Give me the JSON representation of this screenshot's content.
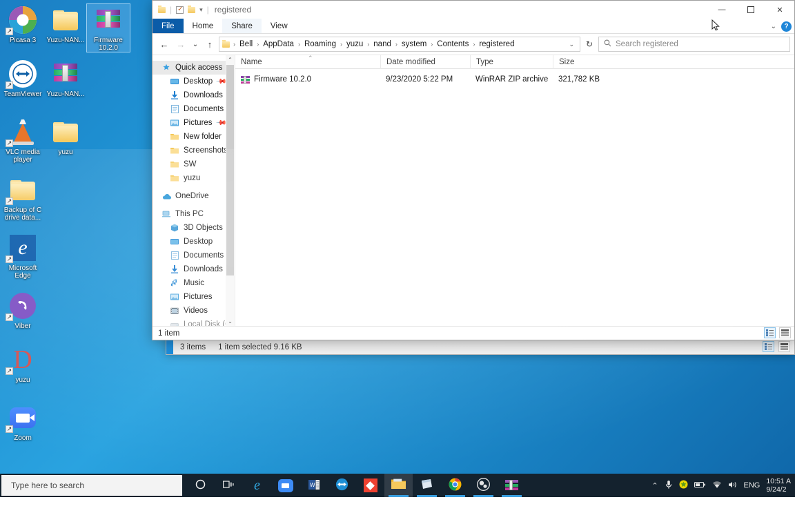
{
  "desktop": {
    "icons_col1": [
      {
        "label": "Picasa 3",
        "icon": "picasa-icon",
        "shortcut": true,
        "selected": false
      },
      {
        "label": "TeamViewer",
        "icon": "teamviewer-icon",
        "shortcut": true,
        "selected": false
      },
      {
        "label": "VLC media player",
        "icon": "vlc-icon",
        "shortcut": true,
        "selected": false
      },
      {
        "label": "Backup of C drive data...",
        "icon": "folder-icon",
        "shortcut": true,
        "selected": false
      },
      {
        "label": "Microsoft Edge",
        "icon": "edge-icon",
        "shortcut": true,
        "selected": false
      },
      {
        "label": "Viber",
        "icon": "viber-icon",
        "shortcut": true,
        "selected": false
      },
      {
        "label": "yuzu",
        "icon": "yuzu-icon",
        "shortcut": true,
        "selected": false
      },
      {
        "label": "Zoom",
        "icon": "zoom-icon",
        "shortcut": true,
        "selected": false
      }
    ],
    "icons_col2": [
      {
        "label": "Yuzu-NAN...",
        "icon": "folder-icon",
        "shortcut": false,
        "selected": false
      },
      {
        "label": "Yuzu-NAN...",
        "icon": "winrar-archive-icon",
        "shortcut": false,
        "selected": false
      },
      {
        "label": "yuzu",
        "icon": "folder-icon",
        "shortcut": false,
        "selected": false
      }
    ],
    "icons_col3": [
      {
        "label": "Firmware 10.2.0",
        "icon": "winrar-archive-icon",
        "shortcut": false,
        "selected": true
      }
    ]
  },
  "window": {
    "title": "registered",
    "quick_access": {
      "folder_icon": "folder-icon",
      "properties_icon": "properties-checkbox-icon",
      "new_folder_icon": "new-folder-icon",
      "dropdown_icon": "chevron-down-icon",
      "separator": "|"
    },
    "controls": {
      "minimize": "—",
      "maximize": "☐",
      "close": "✕",
      "ribbon_collapse": "⌄",
      "help": "?"
    },
    "ribbon_tabs": [
      {
        "label": "File",
        "active": true
      },
      {
        "label": "Home",
        "active": false
      },
      {
        "label": "Share",
        "active": false,
        "hovered": true
      },
      {
        "label": "View",
        "active": false
      }
    ],
    "nav": {
      "back": "←",
      "forward": "→",
      "recent": "⌄",
      "up": "↑",
      "refresh": "↻",
      "address_caret": "⌄"
    },
    "breadcrumbs": [
      "Bell",
      "AppData",
      "Roaming",
      "yuzu",
      "nand",
      "system",
      "Contents",
      "registered"
    ],
    "breadcrumb_separator": "›",
    "search": {
      "placeholder": "Search registered",
      "icon": "search-icon",
      "value": ""
    },
    "sidebar": {
      "scroll_up_icon": "⌃",
      "scroll_down_icon": "⌄",
      "items": [
        {
          "label": "Quick access",
          "icon": "star-icon",
          "indent": 0,
          "selected": true,
          "pinned": false
        },
        {
          "label": "Desktop",
          "icon": "desktop-icon",
          "indent": 1,
          "selected": false,
          "pinned": true
        },
        {
          "label": "Downloads",
          "icon": "download-icon",
          "indent": 1,
          "selected": false,
          "pinned": true
        },
        {
          "label": "Documents",
          "icon": "documents-icon",
          "indent": 1,
          "selected": false,
          "pinned": true
        },
        {
          "label": "Pictures",
          "icon": "pictures-icon",
          "indent": 1,
          "selected": false,
          "pinned": true
        },
        {
          "label": "New folder",
          "icon": "folder-icon",
          "indent": 1,
          "selected": false,
          "pinned": false
        },
        {
          "label": "Screenshots",
          "icon": "folder-icon",
          "indent": 1,
          "selected": false,
          "pinned": false
        },
        {
          "label": "SW",
          "icon": "folder-icon",
          "indent": 1,
          "selected": false,
          "pinned": false
        },
        {
          "label": "yuzu",
          "icon": "folder-icon",
          "indent": 1,
          "selected": false,
          "pinned": false
        },
        {
          "label": "",
          "icon": "spacer",
          "indent": 0,
          "selected": false,
          "pinned": false
        },
        {
          "label": "OneDrive",
          "icon": "onedrive-icon",
          "indent": 0,
          "selected": false,
          "pinned": false
        },
        {
          "label": "",
          "icon": "spacer",
          "indent": 0,
          "selected": false,
          "pinned": false
        },
        {
          "label": "This PC",
          "icon": "thispc-icon",
          "indent": 0,
          "selected": false,
          "pinned": false
        },
        {
          "label": "3D Objects",
          "icon": "3dobjects-icon",
          "indent": 1,
          "selected": false,
          "pinned": false
        },
        {
          "label": "Desktop",
          "icon": "desktop-icon",
          "indent": 1,
          "selected": false,
          "pinned": false
        },
        {
          "label": "Documents",
          "icon": "documents-icon",
          "indent": 1,
          "selected": false,
          "pinned": false
        },
        {
          "label": "Downloads",
          "icon": "download-icon",
          "indent": 1,
          "selected": false,
          "pinned": false
        },
        {
          "label": "Music",
          "icon": "music-icon",
          "indent": 1,
          "selected": false,
          "pinned": false
        },
        {
          "label": "Pictures",
          "icon": "pictures-icon",
          "indent": 1,
          "selected": false,
          "pinned": false
        },
        {
          "label": "Videos",
          "icon": "videos-icon",
          "indent": 1,
          "selected": false,
          "pinned": false
        },
        {
          "label": "Local Disk (C:)",
          "icon": "drive-icon",
          "indent": 1,
          "selected": false,
          "pinned": false
        }
      ]
    },
    "columns": [
      {
        "label": "Name",
        "sorted": true,
        "sort_icon": "⌃"
      },
      {
        "label": "Date modified",
        "sorted": false
      },
      {
        "label": "Type",
        "sorted": false
      },
      {
        "label": "Size",
        "sorted": false
      }
    ],
    "files": [
      {
        "name": "Firmware 10.2.0",
        "icon": "winrar-archive-icon",
        "date_modified": "9/23/2020 5:22 PM",
        "type": "WinRAR ZIP archive",
        "size": "321,782 KB"
      }
    ],
    "status": {
      "item_count": "1 item"
    },
    "view_buttons": [
      {
        "name": "details-view-button",
        "active": true
      },
      {
        "name": "large-icons-view-button",
        "active": false
      }
    ]
  },
  "background_window": {
    "status": {
      "item_count": "3 items",
      "selection": "1 item selected",
      "selection_size": "9.16 KB"
    },
    "faint_row_text": "Local Disk (C:)",
    "view_buttons": [
      {
        "name": "details-view-button",
        "active": true
      },
      {
        "name": "large-icons-view-button",
        "active": false
      }
    ]
  },
  "taskbar": {
    "search_placeholder": "Type here to search",
    "search_icon": "search-icon",
    "buttons": [
      {
        "name": "cortana-button",
        "icon": "circle-icon"
      },
      {
        "name": "task-view-button",
        "icon": "task-view-icon"
      },
      {
        "name": "edge-taskbar-button",
        "icon": "edge-icon"
      },
      {
        "name": "zoom-taskbar-button",
        "icon": "zoom-icon"
      },
      {
        "name": "word-taskbar-button",
        "icon": "word-icon"
      },
      {
        "name": "teamviewer-taskbar-button",
        "icon": "teamviewer-icon"
      },
      {
        "name": "anydesk-taskbar-button",
        "icon": "anydesk-icon"
      },
      {
        "name": "file-explorer-taskbar-button",
        "icon": "folder-icon",
        "running": true,
        "active": true
      },
      {
        "name": "sticky-notes-taskbar-button",
        "icon": "notes-icon",
        "running": true
      },
      {
        "name": "chrome-taskbar-button",
        "icon": "chrome-icon",
        "running": true
      },
      {
        "name": "obs-taskbar-button",
        "icon": "obs-icon",
        "running": true
      },
      {
        "name": "winrar-taskbar-button",
        "icon": "winrar-archive-icon",
        "running": true
      }
    ],
    "tray": {
      "overflow_icon": "chevron-up-icon",
      "mic_icon": "microphone-icon",
      "shield_icon": "security-icon",
      "battery_icon": "battery-icon",
      "wifi_icon": "wifi-icon",
      "volume_icon": "speaker-icon",
      "language": "ENG",
      "time": "10:51 A",
      "date": "9/24/2"
    }
  }
}
